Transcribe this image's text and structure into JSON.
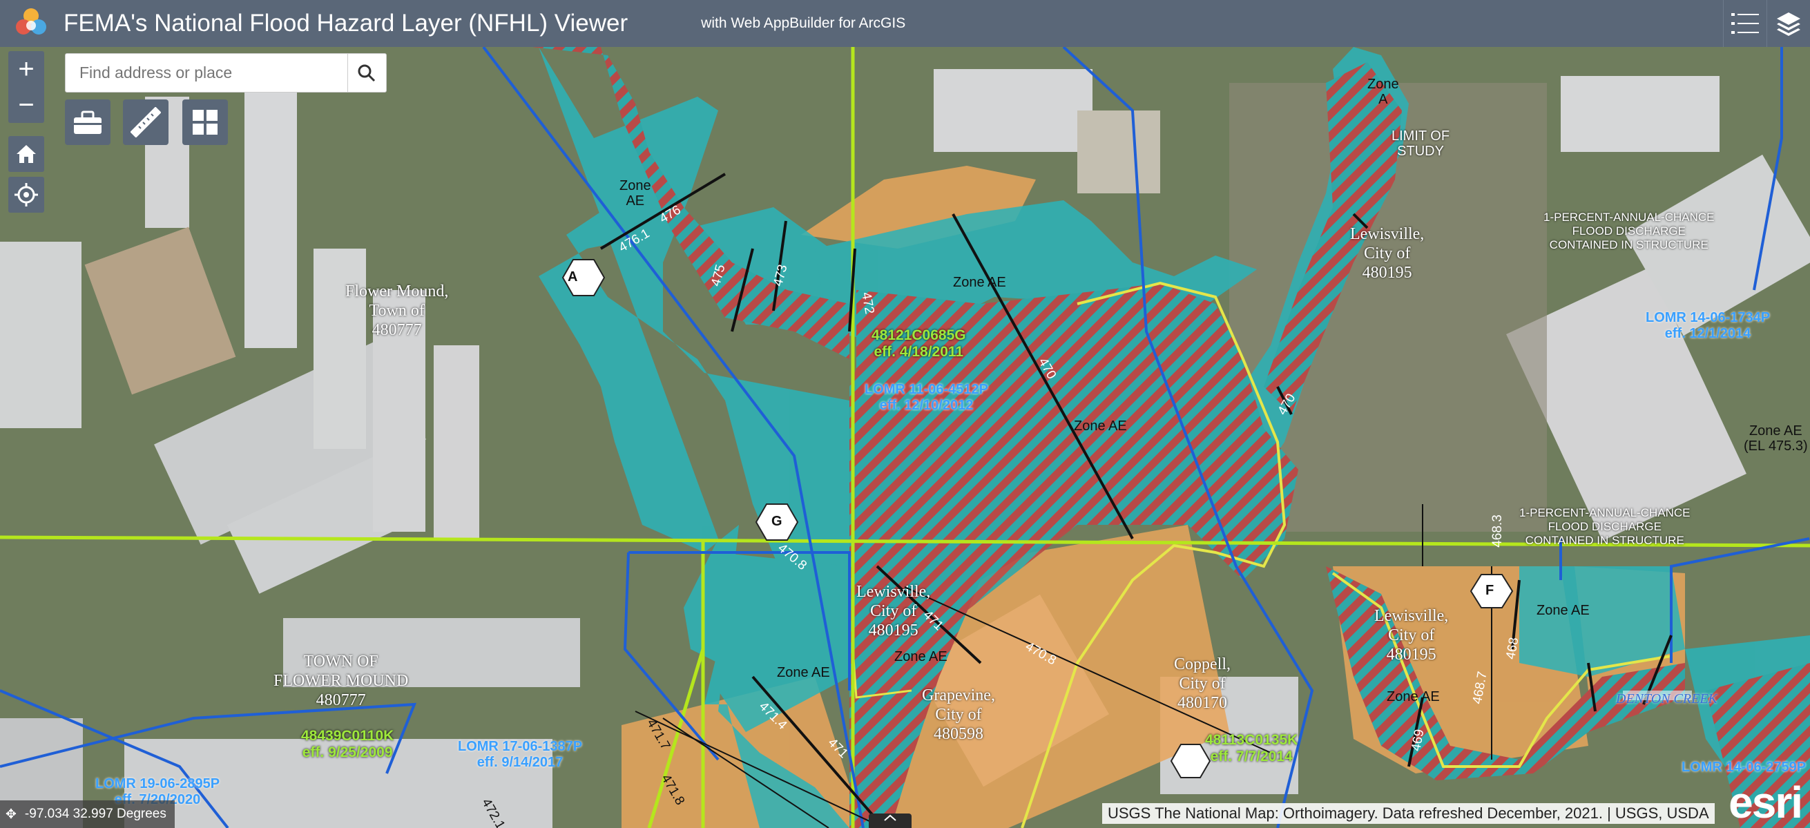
{
  "header": {
    "title": "FEMA's National Flood Hazard Layer (NFHL) Viewer",
    "subtitle": "with Web AppBuilder for ArcGIS",
    "logo_icon": "app-logo-icon",
    "legend_icon": "legend-list-icon",
    "layers_icon": "layers-icon"
  },
  "controls": {
    "zoom_in": "+",
    "zoom_out": "−",
    "home_icon": "home-icon",
    "locate_icon": "locate-icon"
  },
  "search": {
    "placeholder": "Find address or place",
    "search_icon": "search-icon"
  },
  "toolbar": {
    "toolbox_icon": "toolbox-icon",
    "measure_icon": "ruler-icon",
    "basemap_icon": "grid-icon"
  },
  "status": {
    "coordinates": "-97.034 32.997 Degrees",
    "attribution": "USGS The National Map: Orthoimagery. Data refreshed December, 2021. | USGS, USDA",
    "esri": "esri"
  },
  "map_labels": {
    "flower_mound_1": "Flower Mound,",
    "flower_mound_2": "Town of",
    "flower_mound_3": "480777",
    "town_fm_1": "TOWN OF",
    "town_fm_2": "FLOWER MOUND",
    "town_fm_3": "480777",
    "lewis_n_1": "Lewisville,",
    "lewis_n_2": "City of",
    "lewis_n_3": "480195",
    "lewis_c_1": "Lewisville,",
    "lewis_c_2": "City of",
    "lewis_c_3": "480195",
    "lewis_e_1": "Lewisville,",
    "lewis_e_2": "City of",
    "lewis_e_3": "480195",
    "grapevine_1": "Grapevine,",
    "grapevine_2": "City of",
    "grapevine_3": "480598",
    "coppell_1": "Coppell,",
    "coppell_2": "City of",
    "coppell_3": "480170",
    "limit_1": "LIMIT OF",
    "limit_2": "STUDY",
    "disch_a_1": "1-PERCENT-ANNUAL-CHANCE",
    "disch_a_2": "FLOOD DISCHARGE",
    "disch_a_3": "CONTAINED IN STRUCTURE",
    "disch_b_1": "1-PERCENT-ANNUAL-CHANCE",
    "disch_b_2": "FLOOD DISCHARGE",
    "disch_b_3": "CONTAINED IN STRUCTURE",
    "zone_ae": "Zone AE",
    "zone_a": "Zone",
    "zone_a2": "A",
    "zone_ae_el": "(EL 475.3)",
    "denton_creek": "DENTON CREEK",
    "panel_1": "48121C0685G",
    "panel_1_eff": "eff. 4/18/2011",
    "panel_2": "48439C0110K",
    "panel_2_eff": "eff. 9/25/2009",
    "panel_3": "48113C0135K",
    "panel_3_eff": "eff. 7/7/2014",
    "lomr_1": "LOMR 11-06-4512P",
    "lomr_1_eff": "eff. 12/10/2012",
    "lomr_2": "LOMR 17-06-1387P",
    "lomr_2_eff": "eff. 9/14/2017",
    "lomr_3": "LOMR 14-06-1734P",
    "lomr_3_eff": "eff. 12/1/2014",
    "lomr_4": "LOMR 19-06-2895P",
    "lomr_4_eff": "eff. 7/20/2020",
    "lomr_5": "LOMR 14-06-2759P",
    "xs_a": "A",
    "xs_g": "G",
    "xs_f": "F",
    "bfe_476": "476",
    "bfe_4761": "476.1",
    "bfe_475": "475",
    "bfe_473": "473",
    "bfe_472": "472",
    "bfe_470": "470",
    "bfe_4708": "470.8",
    "bfe_471": "471",
    "bfe_4714": "471.4",
    "bfe_4717": "471.7",
    "bfe_4718": "471.8",
    "bfe_469": "469",
    "bfe_4687": "468.7",
    "bfe_468": "468",
    "bfe_4683": "468.3",
    "bfe_4721": "472.1"
  },
  "colors": {
    "header": "#5a6778",
    "zone_ae_fill": "#2bb3b8",
    "floodway_hatch": "#c0392b",
    "zone_x_fill": "#e8a45c",
    "political_boundary": "#b5e61d",
    "lomr_boundary": "#1f5fd6",
    "panel_label": "#9ee83c",
    "lomr_label": "#3aa0ff"
  }
}
